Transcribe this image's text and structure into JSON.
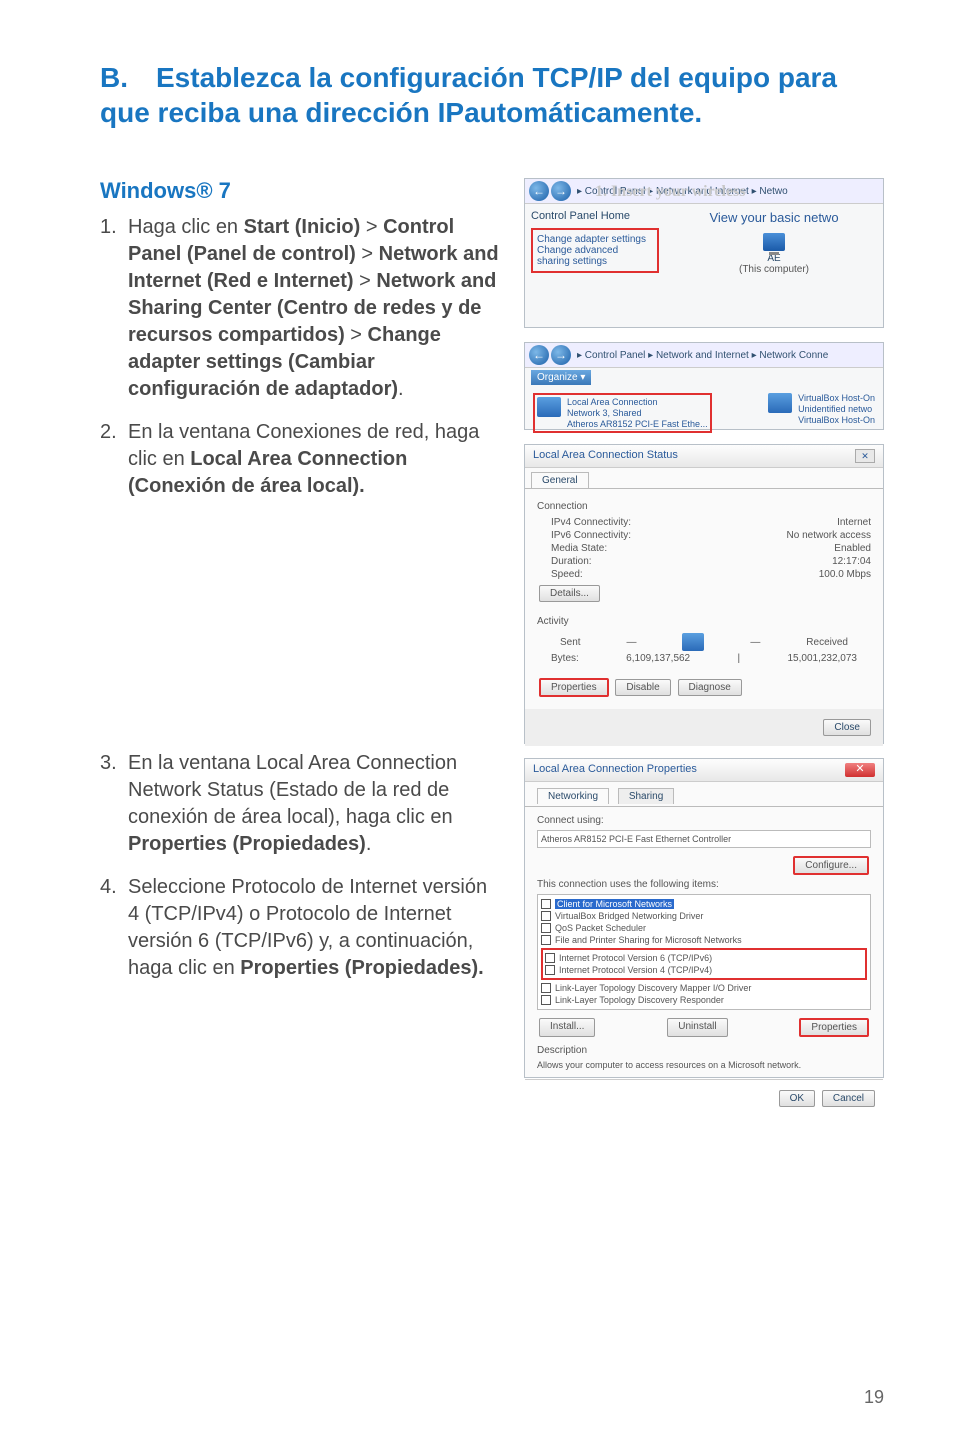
{
  "heading_letter": "B.",
  "heading_text": "Establezca la configuración TCP/IP del equipo para que reciba una dirección IPautomáticamente.",
  "subheading": "Windows® 7",
  "steps": {
    "s1_a": "Haga clic en ",
    "s1_b": "Start (Inicio)",
    "s1_c": " > ",
    "s1_d": "Control Panel (Panel de control)",
    "s1_e": " > ",
    "s1_f": "Network and Internet (Red e Internet)",
    "s1_g": " > ",
    "s1_h": "Network and Sharing Center (Centro de redes y de recursos compartidos)",
    "s1_i": " > ",
    "s1_j": "Change adapter settings (Cambiar configuración de adaptador)",
    "s1_k": ".",
    "s2_a": "En la ventana Conexiones de red, haga clic en ",
    "s2_b": "Local Area Connection (Conexión de área local).",
    "s3_a": "En la ventana Local Area Connection Network Status (Estado de la red de conexión de área local), haga clic en ",
    "s3_b": "Properties (Propiedades)",
    "s3_c": ".",
    "s4_a": "Seleccione Protocolo de Internet versión 4 (TCP/IPv4) o Protocolo de Internet versión 6 (TCP/IPv6) y, a continuación, haga clic en ",
    "s4_b": "Properties (Propiedades)."
  },
  "panel1": {
    "faded": "1. Insert your wireless",
    "crumb": "▸ Control Panel ▸ Network and Internet ▸ Netwo",
    "home": "Control Panel Home",
    "change_adapter": "Change adapter settings",
    "change_advanced": "Change advanced sharing settings",
    "view": "View your basic netwo",
    "comp_label": "AE",
    "this_computer": "(This computer)"
  },
  "panel2": {
    "crumb": "▸ Control Panel ▸ Network and Internet ▸ Network Conne",
    "organize": "Organize ▾",
    "conn1_a": "Local Area Connection",
    "conn1_b": "Network 3, Shared",
    "conn1_c": "Atheros AR8152 PCI-E Fast Ethe...",
    "conn2_a": "VirtualBox Host-On",
    "conn2_b": "Unidentified netwo",
    "conn2_c": "VirtualBox Host-On"
  },
  "panel3": {
    "title": "Local Area Connection Status",
    "tab": "General",
    "sec1": "Connection",
    "ipv4_l": "IPv4 Connectivity:",
    "ipv4_v": "Internet",
    "ipv6_l": "IPv6 Connectivity:",
    "ipv6_v": "No network access",
    "media_l": "Media State:",
    "media_v": "Enabled",
    "dur_l": "Duration:",
    "dur_v": "12:17:04",
    "speed_l": "Speed:",
    "speed_v": "100.0 Mbps",
    "details": "Details...",
    "sec2": "Activity",
    "sent": "Sent",
    "recv": "Received",
    "bytes_l": "Bytes:",
    "bytes_sent": "6,109,137,562",
    "bytes_recv": "15,001,232,073",
    "props": "Properties",
    "disable": "Disable",
    "diag": "Diagnose",
    "close": "Close"
  },
  "panel4": {
    "title": "Local Area Connection Properties",
    "tab1": "Networking",
    "tab2": "Sharing",
    "connect_using": "Connect using:",
    "adapter": "Atheros AR8152 PCI-E Fast Ethernet Controller",
    "configure": "Configure...",
    "list_intro": "This connection uses the following items:",
    "item1": "Client for Microsoft Networks",
    "item2": "VirtualBox Bridged Networking Driver",
    "item3": "QoS Packet Scheduler",
    "item4": "File and Printer Sharing for Microsoft Networks",
    "item5": "Internet Protocol Version 6 (TCP/IPv6)",
    "item6": "Internet Protocol Version 4 (TCP/IPv4)",
    "item7": "Link-Layer Topology Discovery Mapper I/O Driver",
    "item8": "Link-Layer Topology Discovery Responder",
    "install": "Install...",
    "uninstall": "Uninstall",
    "properties": "Properties",
    "desc_h": "Description",
    "desc_t": "Allows your computer to access resources on a Microsoft network.",
    "ok": "OK",
    "cancel": "Cancel"
  },
  "page_number": "19"
}
